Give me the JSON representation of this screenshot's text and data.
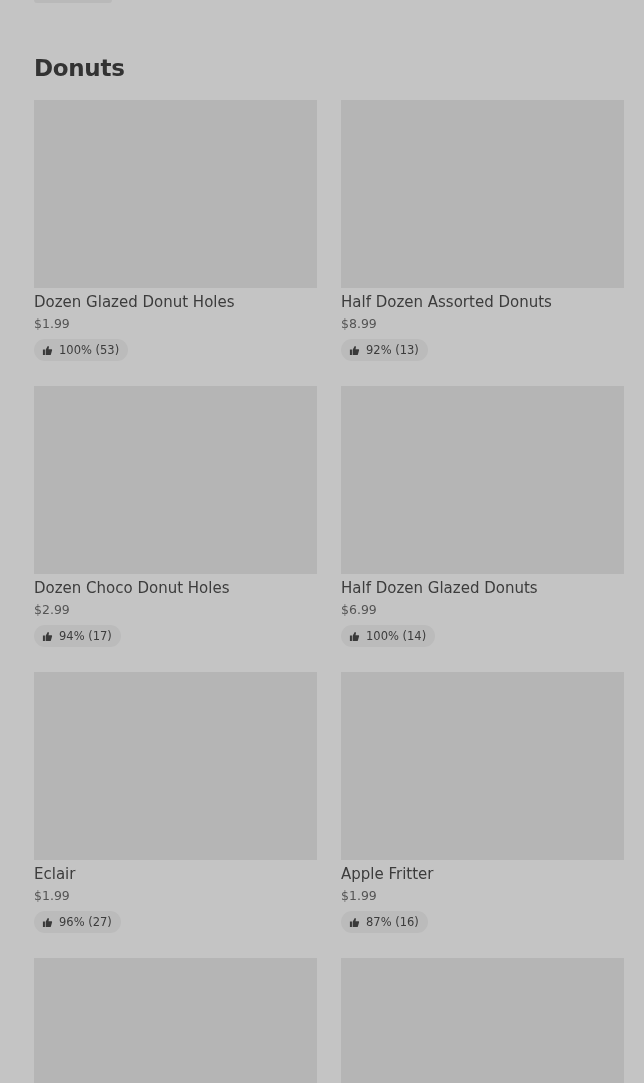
{
  "section": {
    "title": "Donuts"
  },
  "items": [
    {
      "kind": "product",
      "name": "Dozen Glazed Donut Holes",
      "price": "$1.99",
      "rating": "100% (53)"
    },
    {
      "kind": "product",
      "name": "Half Dozen Assorted Donuts",
      "price": "$8.99",
      "rating": "92% (13)"
    },
    {
      "kind": "product",
      "name": "Dozen Choco Donut Holes",
      "price": "$2.99",
      "rating": "94% (17)"
    },
    {
      "kind": "product",
      "name": "Half Dozen Glazed Donuts",
      "price": "$6.99",
      "rating": "100% (14)"
    },
    {
      "kind": "product",
      "name": "Eclair",
      "price": "$1.99",
      "rating": "96% (27)"
    },
    {
      "kind": "product",
      "name": "Apple Fritter",
      "price": "$1.99",
      "rating": "87% (16)"
    },
    {
      "kind": "picture"
    },
    {
      "kind": "picture"
    }
  ]
}
